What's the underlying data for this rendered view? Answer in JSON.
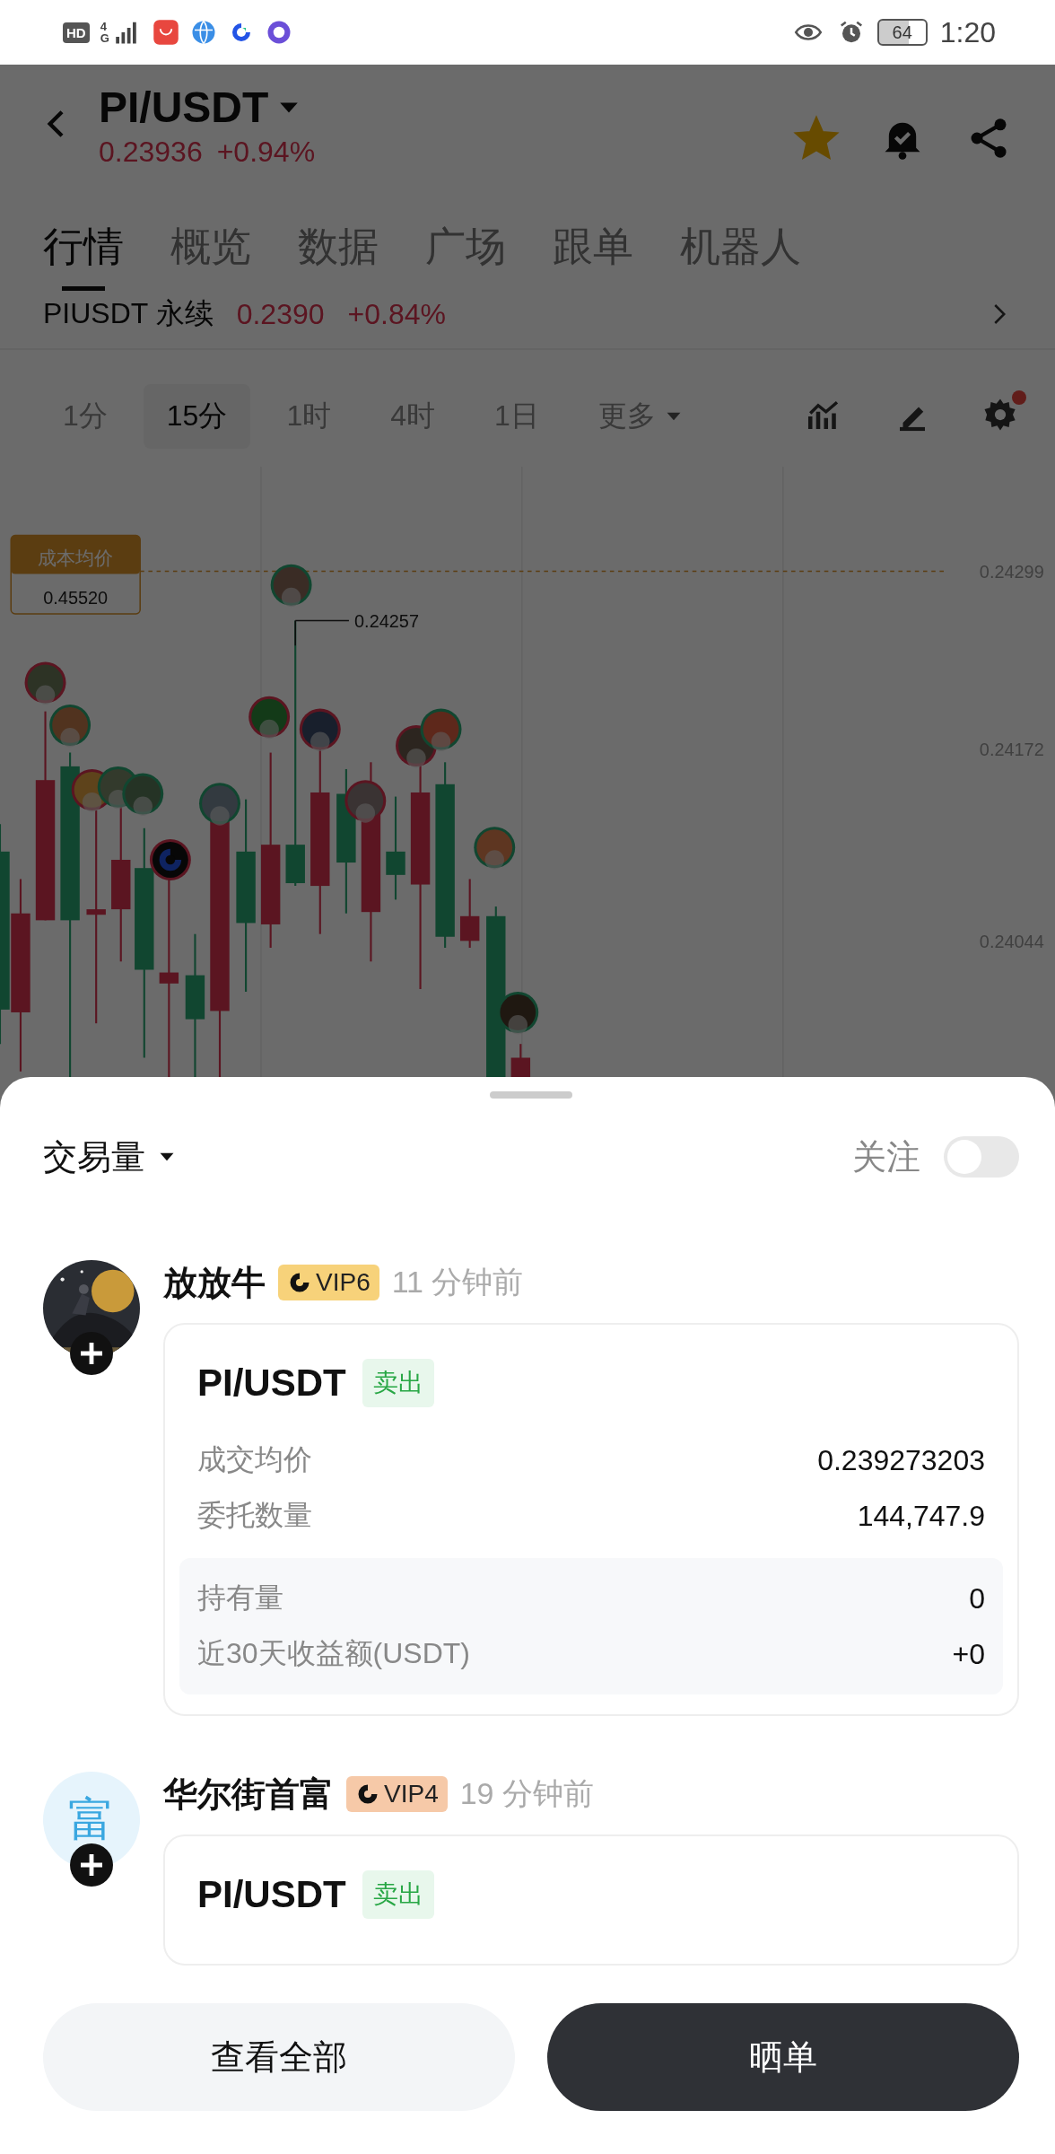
{
  "status_bar": {
    "hd": "HD",
    "network": "4G",
    "battery": "64",
    "time": "1:20"
  },
  "header": {
    "pair": "PI/USDT",
    "price": "0.23936",
    "change": "+0.94%",
    "favorite": true
  },
  "tabs": [
    {
      "label": "行情",
      "selected": true
    },
    {
      "label": "概览",
      "selected": false
    },
    {
      "label": "数据",
      "selected": false
    },
    {
      "label": "广场",
      "selected": false
    },
    {
      "label": "跟单",
      "selected": false
    },
    {
      "label": "机器人",
      "selected": false
    }
  ],
  "perpetual": {
    "pair": "PIUSDT",
    "type": "永续",
    "price": "0.2390",
    "change": "+0.84%"
  },
  "intervals": [
    {
      "label": "1分",
      "selected": false
    },
    {
      "label": "15分",
      "selected": true
    },
    {
      "label": "1时",
      "selected": false
    },
    {
      "label": "4时",
      "selected": false
    },
    {
      "label": "1日",
      "selected": false
    }
  ],
  "more": "更多",
  "settings_alert": true,
  "chart": {
    "cost_label": "成本均价",
    "cost_value": "0.45520",
    "peak_label": "0.24257",
    "price_labels": [
      "0.24299",
      "0.24172",
      "0.24044"
    ]
  },
  "sheet": {
    "sort_label": "交易量",
    "follow_label": "关注",
    "follow_on": false
  },
  "posts": [
    {
      "name": "放放牛",
      "vip": "VIP6",
      "color": "#f7d27a",
      "time": "11 分钟前",
      "avatar": {
        "kind": "picture"
      },
      "pair": "PI/USDT",
      "side": "卖出",
      "rows": [
        {
          "label": "成交均价",
          "value": "0.239273203"
        },
        {
          "label": "委托数量",
          "value": "144,747.9"
        }
      ],
      "stats": [
        {
          "label": "持有量",
          "value": "0"
        },
        {
          "label": "近30天收益额(USDT)",
          "value": "+0"
        }
      ]
    },
    {
      "name": "华尔街首富",
      "vip": "VIP4",
      "color": "#f6c9a8",
      "time": "19 分钟前",
      "avatar": {
        "kind": "letter",
        "letter": "富"
      },
      "pair": "PI/USDT",
      "side": "卖出"
    }
  ],
  "buttons": [
    {
      "label": "查看全部",
      "kind": "secondary"
    },
    {
      "label": "晒单",
      "kind": "primary"
    }
  ]
}
